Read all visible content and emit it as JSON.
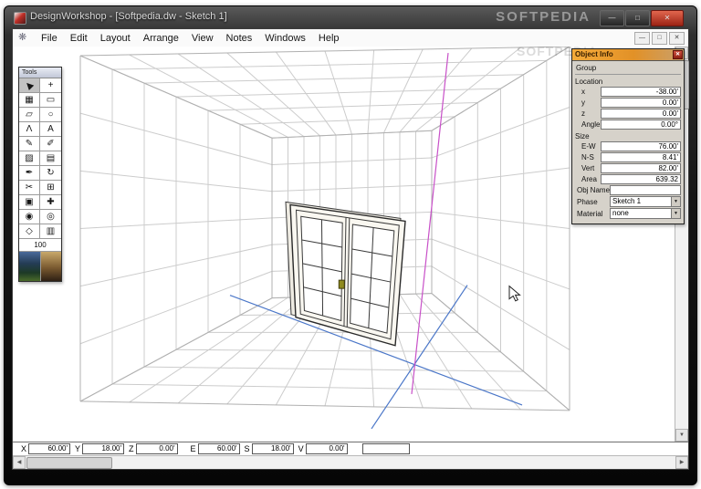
{
  "window": {
    "title": "DesignWorkshop - [Softpedia.dw - Sketch 1]",
    "watermark": "SOFTPEDIA",
    "controls": {
      "minimize": "—",
      "maximize": "□",
      "close": "✕"
    }
  },
  "menu": {
    "app_icon": "❋",
    "items": [
      "File",
      "Edit",
      "Layout",
      "Arrange",
      "View",
      "Notes",
      "Windows",
      "Help"
    ],
    "mdi": {
      "minimize": "—",
      "restore": "□",
      "close": "✕"
    }
  },
  "tools_palette": {
    "title": "Tools",
    "tools": [
      {
        "name": "pointer",
        "glyph": "▶"
      },
      {
        "name": "move",
        "glyph": "+"
      },
      {
        "name": "marquee",
        "glyph": "▦"
      },
      {
        "name": "rectangle",
        "glyph": "▭"
      },
      {
        "name": "parallelogram",
        "glyph": "▱"
      },
      {
        "name": "ellipse",
        "glyph": "○"
      },
      {
        "name": "polyline",
        "glyph": "Λ"
      },
      {
        "name": "text",
        "glyph": "A"
      },
      {
        "name": "pencil",
        "glyph": "✎"
      },
      {
        "name": "pen",
        "glyph": "✐"
      },
      {
        "name": "hatch",
        "glyph": "▨"
      },
      {
        "name": "stamp",
        "glyph": "▤"
      },
      {
        "name": "eyedropper",
        "glyph": "✒"
      },
      {
        "name": "rotate",
        "glyph": "↻"
      },
      {
        "name": "trim",
        "glyph": "✂"
      },
      {
        "name": "grid",
        "glyph": "⊞"
      },
      {
        "name": "layers",
        "glyph": "▣"
      },
      {
        "name": "measure",
        "glyph": "✚"
      },
      {
        "name": "eye",
        "glyph": "◉"
      },
      {
        "name": "camera",
        "glyph": "◎"
      },
      {
        "name": "box3d",
        "glyph": "◇"
      },
      {
        "name": "walls",
        "glyph": "▥"
      }
    ],
    "zoom_value": "100"
  },
  "object_info": {
    "title": "Object Info",
    "close_icon": "✕",
    "group_label": "Group",
    "location_label": "Location",
    "location": [
      {
        "label": "x",
        "value": "-38.00'"
      },
      {
        "label": "y",
        "value": "0.00'"
      },
      {
        "label": "z",
        "value": "0.00'"
      },
      {
        "label": "Angle",
        "value": "0.00°"
      }
    ],
    "size_label": "Size",
    "size": [
      {
        "label": "E-W",
        "value": "76.00'"
      },
      {
        "label": "N-S",
        "value": "8.41'"
      },
      {
        "label": "Vert",
        "value": "82.00'"
      },
      {
        "label": "Area",
        "value": "639.32"
      }
    ],
    "obj_name_label": "Obj Name",
    "obj_name_value": "",
    "phase_label": "Phase",
    "phase_value": "Sketch 1",
    "material_label": "Material",
    "material_value": "none",
    "dropdown_arrow": "▼"
  },
  "coordinate_bar": {
    "fields": [
      {
        "label": "X",
        "value": "60.00'"
      },
      {
        "label": "Y",
        "value": "18.00'"
      },
      {
        "label": "Z",
        "value": "0.00'"
      },
      {
        "label": "E",
        "value": "60.00'"
      },
      {
        "label": "S",
        "value": "18.00'"
      },
      {
        "label": "V",
        "value": "0.00'"
      }
    ],
    "extra_value": ""
  },
  "scrollbars": {
    "up": "▲",
    "down": "▼",
    "left": "◀",
    "right": "▶"
  },
  "colors": {
    "axis_blue": "#4a76c8",
    "axis_magenta": "#c850c8",
    "grid": "#cccccc",
    "grid_edge": "#b0b0b0",
    "palette_title_orange": "#f0a13c",
    "close_red": "#c0392b"
  }
}
